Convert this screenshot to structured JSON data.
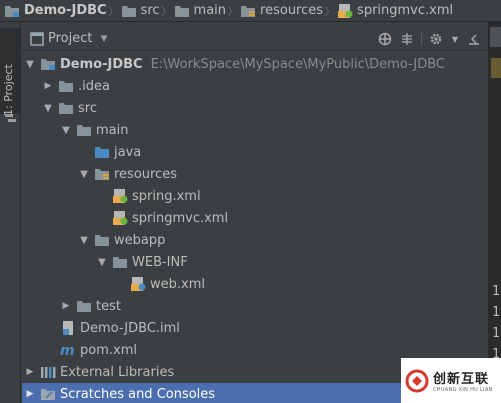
{
  "breadcrumbs": [
    {
      "label": "Demo-JDBC",
      "icon": "module-folder-icon"
    },
    {
      "label": "src",
      "icon": "folder-icon"
    },
    {
      "label": "main",
      "icon": "folder-icon"
    },
    {
      "label": "resources",
      "icon": "resources-folder-icon"
    },
    {
      "label": "springmvc.xml",
      "icon": "spring-xml-icon"
    }
  ],
  "stripe": {
    "project_tab_label": "1: Project"
  },
  "panel": {
    "title": "Project",
    "view_icon": "project-view-icon"
  },
  "toolbar": {
    "icons": [
      "scroll-from-source-icon",
      "collapse-all-icon",
      "settings-gear-icon",
      "hide-panel-icon"
    ]
  },
  "tree": {
    "project": {
      "label": "Demo-JDBC",
      "path": "E:\\WorkSpace\\MySpace\\MyPublic\\Demo-JDBC"
    },
    "idea": {
      "label": ".idea"
    },
    "src": {
      "label": "src"
    },
    "main": {
      "label": "main"
    },
    "java": {
      "label": "java"
    },
    "resources": {
      "label": "resources"
    },
    "spring_xml": {
      "label": "spring.xml"
    },
    "springmvc_xml": {
      "label": "springmvc.xml"
    },
    "webapp": {
      "label": "webapp"
    },
    "web_inf": {
      "label": "WEB-INF"
    },
    "web_xml": {
      "label": "web.xml"
    },
    "test": {
      "label": "test"
    },
    "iml": {
      "label": "Demo-JDBC.iml"
    },
    "pom": {
      "label": "pom.xml"
    },
    "external_libraries": {
      "label": "External Libraries"
    },
    "scratches": {
      "label": "Scratches and Consoles"
    }
  },
  "editor": {
    "gutter_numbers": [
      "1",
      "1",
      "1",
      "1"
    ]
  },
  "watermark": {
    "main": "创新互联",
    "sub": "CHUANG XIN HU LIAN"
  },
  "colors": {
    "background": "#3c3f41",
    "selection": "#4b6eaf",
    "folder": "#87939a",
    "source_folder": "#4a8cc2",
    "xml_badge": "#e8a94a"
  }
}
